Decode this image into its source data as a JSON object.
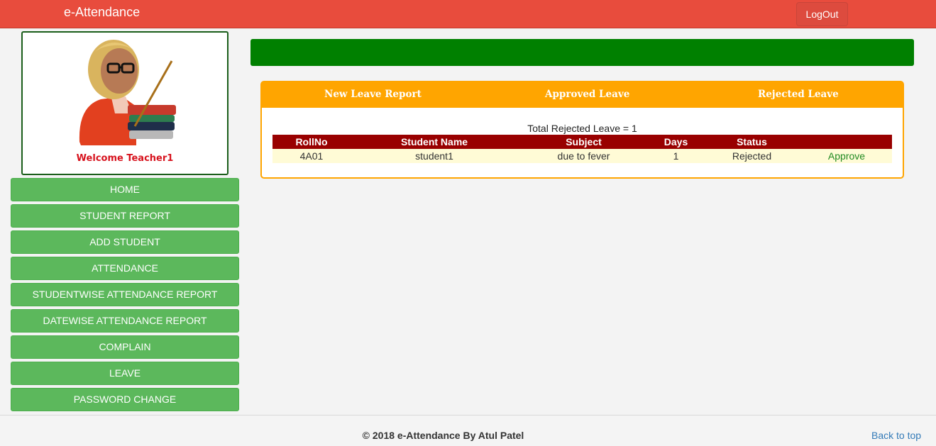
{
  "navbar": {
    "brand": "e-Attendance",
    "logout_label": "LogOut"
  },
  "profile": {
    "avatar_icon": "teacher-avatar-icon",
    "welcome": "Welcome Teacher1"
  },
  "menu": {
    "items": [
      {
        "label": "HOME"
      },
      {
        "label": "STUDENT REPORT"
      },
      {
        "label": "ADD STUDENT"
      },
      {
        "label": "ATTENDANCE"
      },
      {
        "label": "STUDENTWISE ATTENDANCE REPORT"
      },
      {
        "label": "DATEWISE ATTENDANCE REPORT"
      },
      {
        "label": "COMPLAIN"
      },
      {
        "label": "LEAVE"
      },
      {
        "label": "PASSWORD CHANGE"
      }
    ]
  },
  "leave": {
    "tabs": [
      "New Leave Report",
      "Approved Leave",
      "Rejected Leave"
    ],
    "total": "Total Rejected Leave = 1",
    "columns": [
      "RollNo",
      "Student Name",
      "Subject",
      "Days",
      "Status",
      ""
    ],
    "rows": [
      {
        "rollno": "4A01",
        "name": "student1",
        "subject": "due to fever",
        "days": "1",
        "status": "Rejected",
        "action": "Approve"
      }
    ]
  },
  "footer": {
    "copyright": "© 2018 e-Attendance By Atul Patel",
    "back_to_top": "Back to top"
  },
  "colors": {
    "navbar": "#e84c3d",
    "menu_button": "#5cb85c",
    "green_bar": "#008000",
    "panel_accent": "#ffa500",
    "table_header": "#990000",
    "approve_link": "#228b22"
  }
}
